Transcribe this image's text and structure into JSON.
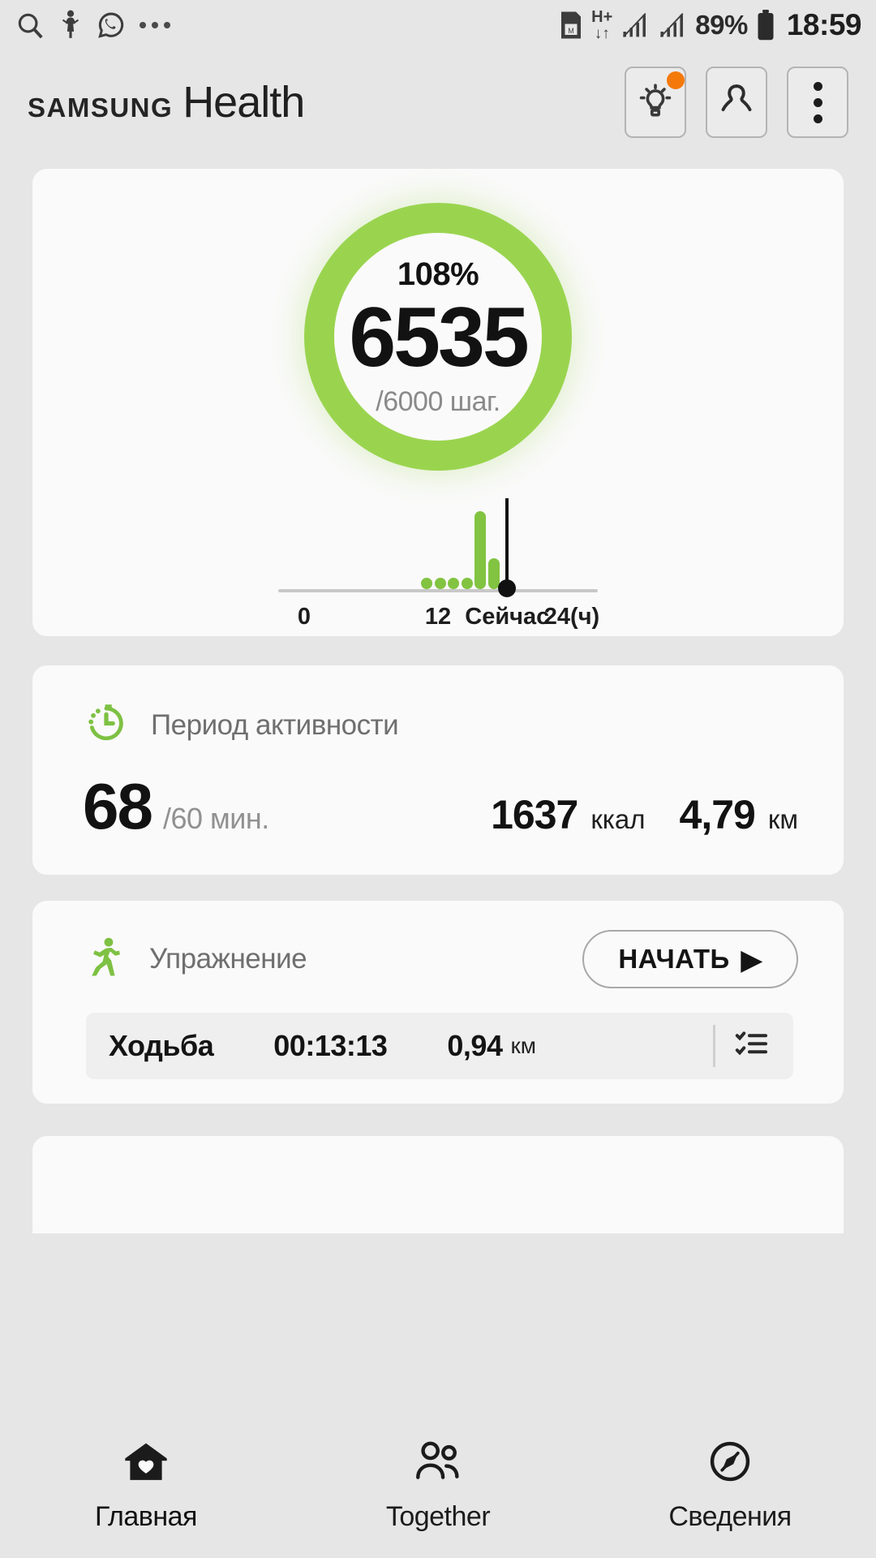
{
  "statusbar": {
    "left_icons": [
      "search-icon",
      "notification-person-icon",
      "whatsapp-icon",
      "more-dots-icon"
    ],
    "sim_icon": "sim-card-icon",
    "network_label_top": "H+",
    "network_label_bottom": "↓↑",
    "signal_icons": [
      "signal-bars-icon",
      "signal-bars-icon"
    ],
    "battery_percent": "89%",
    "battery_icon": "battery-icon",
    "clock": "18:59"
  },
  "header": {
    "brand": "SAMSUNG",
    "app_name": "Health",
    "tips_icon": "lightbulb-icon",
    "tips_badge": true,
    "profile_icon": "profile-person-icon",
    "menu_icon": "kebab-menu-icon",
    "badge_color": "#f4790b"
  },
  "steps_card": {
    "percent": "108%",
    "steps": "6535",
    "goal": "/6000 шаг.",
    "ring_color": "#9ad44f",
    "chart_data": {
      "type": "bar",
      "title": "",
      "xlabel": "",
      "ylabel": "",
      "categories": [
        "",
        "",
        "",
        "",
        "",
        "",
        ""
      ],
      "x": [
        11.0,
        12.2,
        13.4,
        14.6,
        15.8,
        17.0
      ],
      "values": [
        2,
        2,
        2,
        2,
        86,
        34
      ],
      "ylim": [
        0,
        100
      ],
      "xlim": [
        0,
        24
      ],
      "grid": false,
      "bar_color": "#82c341",
      "now_marker": {
        "label": "Сейчас",
        "x": 18.2,
        "color": "#111111"
      },
      "axis_ticks": [
        {
          "label": "0",
          "x": 0
        },
        {
          "label": "12",
          "x": 12
        },
        {
          "label": "Сейчас",
          "x": 18.2
        },
        {
          "label": "24(ч)",
          "x": 24
        }
      ]
    }
  },
  "activity_card": {
    "icon": "stopwatch-icon",
    "title": "Период активности",
    "minutes": "68",
    "minutes_goal": "/60 мин.",
    "calories_value": "1637",
    "calories_unit": "ккал",
    "distance_value": "4,79",
    "distance_unit": "км"
  },
  "exercise_card": {
    "icon": "running-person-icon",
    "title": "Упражнение",
    "start_label": "НАЧАТЬ",
    "start_arrow": "▶",
    "entry": {
      "name": "Ходьба",
      "duration": "00:13:13",
      "distance": "0,94",
      "distance_unit": "км",
      "list_icon": "list-icon"
    }
  },
  "bottomnav": {
    "items": [
      {
        "icon": "home-heart-icon",
        "label": "Главная",
        "active": true
      },
      {
        "icon": "people-icon",
        "label": "Together",
        "active": false
      },
      {
        "icon": "compass-icon",
        "label": "Сведения",
        "active": false
      }
    ]
  }
}
